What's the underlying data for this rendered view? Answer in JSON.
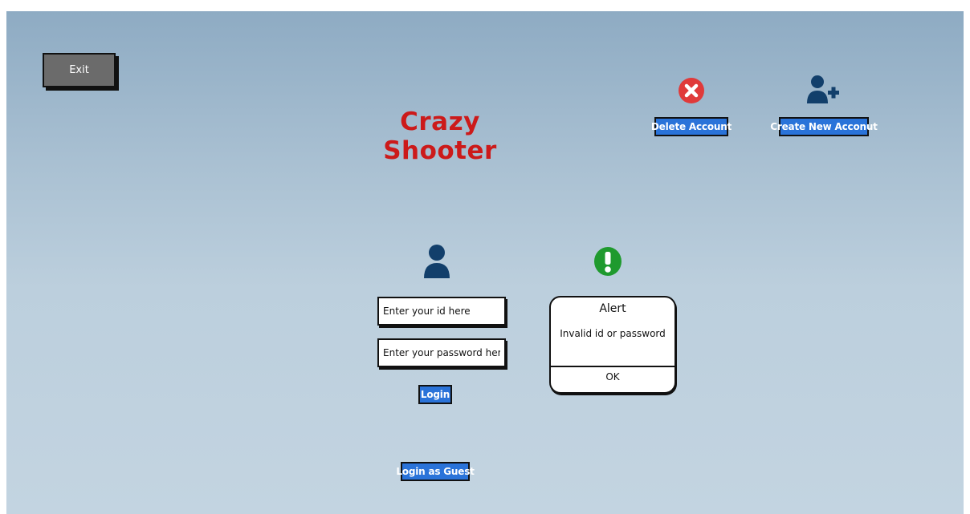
{
  "app": {
    "title": "Crazy Shooter"
  },
  "toolbar": {
    "exit_label": "Exit",
    "delete_account_label": "Delete Account",
    "create_account_label": "Create New Acconut"
  },
  "login": {
    "id_placeholder": "Enter your id here",
    "password_placeholder": "Enter your password here",
    "login_label": "Login",
    "guest_label": "Login as Guest"
  },
  "alert": {
    "title": "Alert",
    "message": "Invalid id or password",
    "ok_label": "OK"
  },
  "icons": {
    "delete": "delete-circle-x-icon",
    "add_user": "user-plus-icon",
    "user": "user-icon",
    "warning": "exclamation-circle-icon"
  },
  "colors": {
    "title": "#cc1a1a",
    "button_blue": "#2a73d9",
    "exit_gray": "#6b6b6b",
    "delete_red": "#e03a3a",
    "warning_green": "#1f9a2e",
    "user_navy": "#123f6b"
  }
}
